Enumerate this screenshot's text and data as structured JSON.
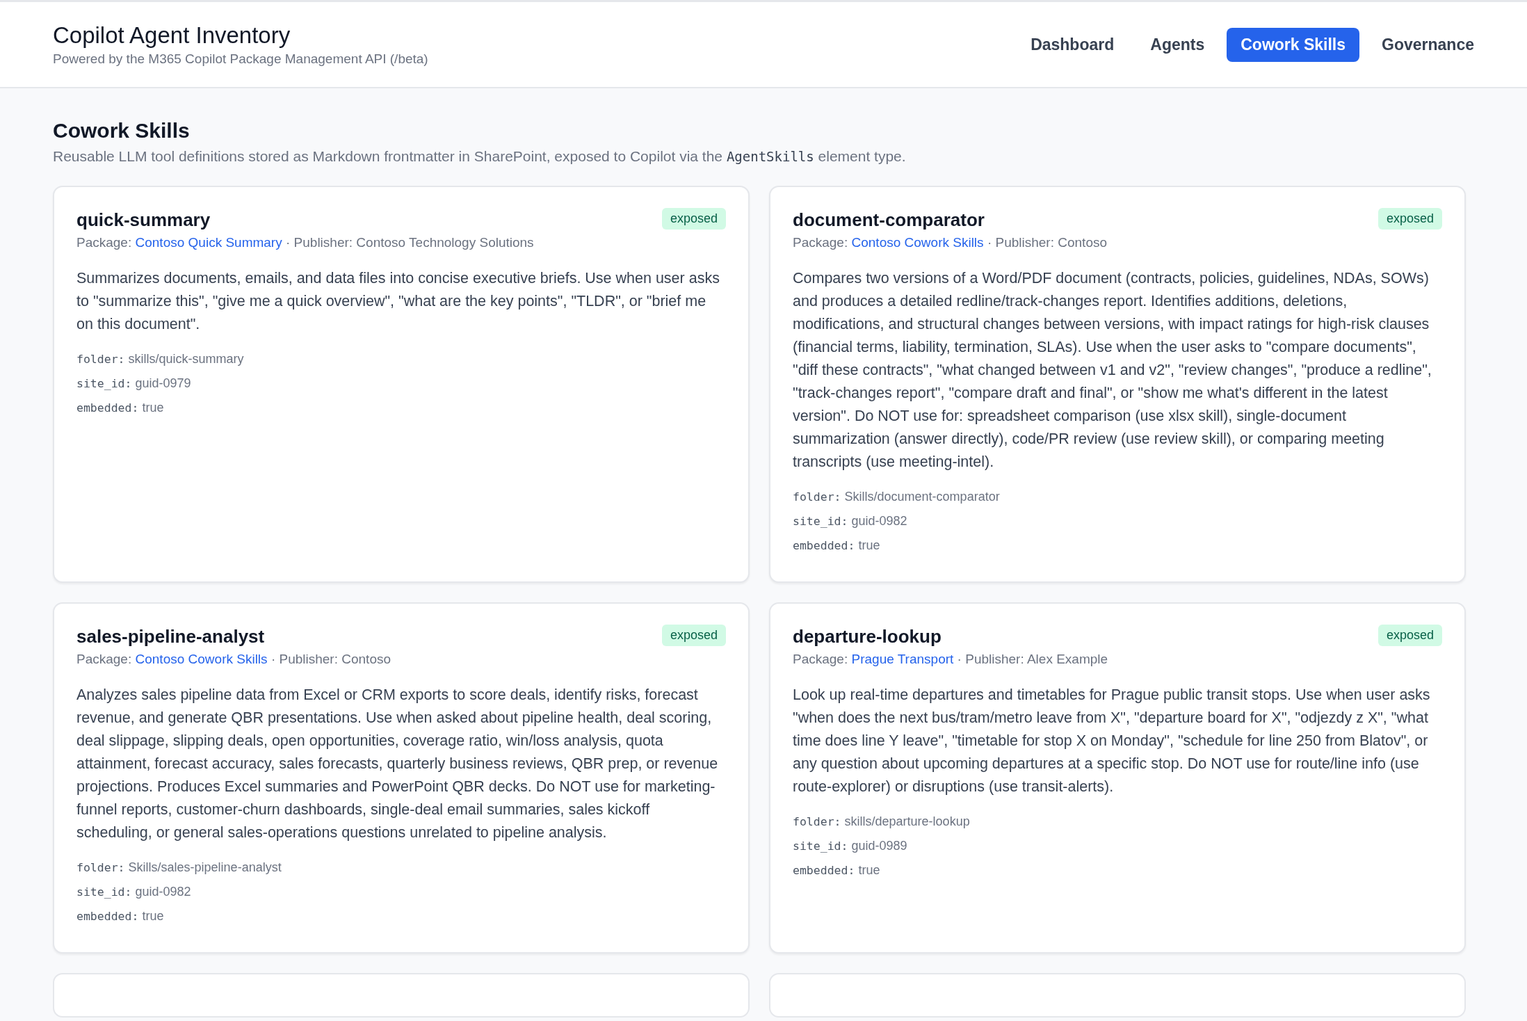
{
  "header": {
    "title": "Copilot Agent Inventory",
    "subtitle": "Powered by the M365 Copilot Package Management API (/beta)"
  },
  "nav": [
    {
      "label": "Dashboard",
      "selected": false
    },
    {
      "label": "Agents",
      "selected": false
    },
    {
      "label": "Cowork Skills",
      "selected": true
    },
    {
      "label": "Governance",
      "selected": false
    }
  ],
  "section": {
    "title": "Cowork Skills",
    "description": [
      {
        "kind": "text",
        "text": "Reusable LLM tool definitions stored as Markdown frontmatter in SharePoint, exposed to Copilot via the "
      },
      {
        "kind": "code",
        "text": "AgentSkills"
      },
      {
        "kind": "text",
        "text": " element type."
      }
    ]
  },
  "skills": [
    {
      "name": "quick-summary",
      "badge": "exposed",
      "package_label": "Package:",
      "package": "Contoso Quick Summary",
      "publisher": "· Publisher: Contoso Technology Solutions",
      "description": "Summarizes documents, emails, and data files into concise executive briefs. Use when user asks to \"summarize this\", \"give me a quick overview\", \"what are the key points\", \"TLDR\", or \"brief me on this document\".",
      "fields": [
        {
          "key": "folder:",
          "value": "skills/quick-summary"
        },
        {
          "key": "site_id:",
          "value": "guid-0979"
        },
        {
          "key": "embedded:",
          "value": "true"
        }
      ]
    },
    {
      "name": "document-comparator",
      "badge": "exposed",
      "package_label": "Package:",
      "package": "Contoso Cowork Skills",
      "publisher": "· Publisher: Contoso",
      "description": "Compares two versions of a Word/PDF document (contracts, policies, guidelines, NDAs, SOWs) and produces a detailed redline/track-changes report. Identifies additions, deletions, modifications, and structural changes between versions, with impact ratings for high-risk clauses (financial terms, liability, termination, SLAs). Use when the user asks to \"compare documents\", \"diff these contracts\", \"what changed between v1 and v2\", \"review changes\", \"produce a redline\", \"track-changes report\", \"compare draft and final\", or \"show me what's different in the latest version\". Do NOT use for: spreadsheet comparison (use xlsx skill), single-document summarization (answer directly), code/PR review (use review skill), or comparing meeting transcripts (use meeting-intel).",
      "fields": [
        {
          "key": "folder:",
          "value": "Skills/document-comparator"
        },
        {
          "key": "site_id:",
          "value": "guid-0982"
        },
        {
          "key": "embedded:",
          "value": "true"
        }
      ]
    },
    {
      "name": "sales-pipeline-analyst",
      "badge": "exposed",
      "package_label": "Package:",
      "package": "Contoso Cowork Skills",
      "publisher": "· Publisher: Contoso",
      "description": "Analyzes sales pipeline data from Excel or CRM exports to score deals, identify risks, forecast revenue, and generate QBR presentations. Use when asked about pipeline health, deal scoring, deal slippage, slipping deals, open opportunities, coverage ratio, win/loss analysis, quota attainment, forecast accuracy, sales forecasts, quarterly business reviews, QBR prep, or revenue projections. Produces Excel summaries and PowerPoint QBR decks. Do NOT use for marketing-funnel reports, customer-churn dashboards, single-deal email summaries, sales kickoff scheduling, or general sales-operations questions unrelated to pipeline analysis.",
      "fields": [
        {
          "key": "folder:",
          "value": "Skills/sales-pipeline-analyst"
        },
        {
          "key": "site_id:",
          "value": "guid-0982"
        },
        {
          "key": "embedded:",
          "value": "true"
        }
      ]
    },
    {
      "name": "departure-lookup",
      "badge": "exposed",
      "package_label": "Package:",
      "package": "Prague Transport",
      "publisher": "· Publisher: Alex Example",
      "description": "Look up real-time departures and timetables for Prague public transit stops. Use when user asks \"when does the next bus/tram/metro leave from X\", \"departure board for X\", \"odjezdy z X\", \"what time does line Y leave\", \"timetable for stop X on Monday\", \"schedule for line 250 from Blatov\", or any question about upcoming departures at a specific stop. Do NOT use for route/line info (use route-explorer) or disruptions (use transit-alerts).",
      "fields": [
        {
          "key": "folder:",
          "value": "skills/departure-lookup"
        },
        {
          "key": "site_id:",
          "value": "guid-0989"
        },
        {
          "key": "embedded:",
          "value": "true"
        }
      ]
    }
  ]
}
